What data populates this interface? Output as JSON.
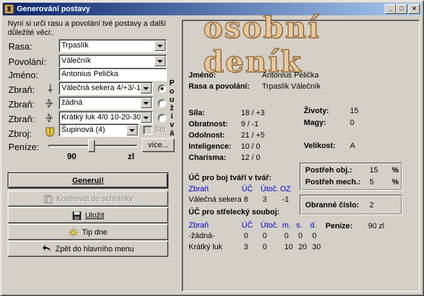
{
  "window": {
    "title": "Generování postavy",
    "btn_min": "_",
    "btn_max": "□",
    "btn_close": "×"
  },
  "form": {
    "intro": "Nyní si urči rasu a povolání tvé postavy a další důležité věci:.",
    "rasa_label": "Rasa:",
    "rasa_value": "Trpaslík",
    "povolani_label": "Povolání:",
    "povolani_value": "Válečník",
    "jmeno_label": "Jméno:",
    "jmeno_value": "Antonius Pelička",
    "zbran_label": "Zbraň:",
    "zbran1_value": "Válečná sekera  4/+3/-1",
    "zbran2_value": "žádná",
    "zbran3_value": "Krátký luk  4/0  10-20-30",
    "zbroj_label": "Zbroj:",
    "zbroj_value": "Šupinová (4)",
    "stit_label": "Štít",
    "pouziva_letters": [
      "P",
      "o",
      "u",
      "ž",
      "í",
      "v",
      "á"
    ],
    "penize_label": "Peníze:",
    "penize_value": "90",
    "penize_unit": "zl",
    "penize_slider_fraction": 0.48,
    "vice_button": "více..."
  },
  "buttons": {
    "generuj": "Generuj!",
    "kopirovat": "Kopírovat do schránky",
    "ulozit": "Uložit",
    "tip": "Tip dne",
    "zpet": "Zpět do hlavního menu"
  },
  "denik": {
    "title": "osobní deník",
    "jmeno_label": "Jméno:",
    "jmeno_value": "Antonius Pelička",
    "rasa_label": "Rasa a povolání:",
    "rasa_value": "Trpaslík Válečník",
    "stats": [
      {
        "label": "Síla:",
        "value": "18 / +3"
      },
      {
        "label": "Obratnost:",
        "value": "9 / -1"
      },
      {
        "label": "Odolnost:",
        "value": "21 / +5"
      },
      {
        "label": "Inteligence:",
        "value": "10 / 0"
      },
      {
        "label": "Charisma:",
        "value": "12 / 0"
      }
    ],
    "zivoty_label": "Životy:",
    "zivoty_value": "15",
    "magy_label": "Magy:",
    "magy_value": "0",
    "velikost_label": "Velikost:",
    "velikost_value": "A",
    "postreh_obj_label": "Postřeh obj.:",
    "postreh_obj_value": "15",
    "postreh_mech_label": "Postřeh mech.:",
    "postreh_mech_value": "5",
    "pct": "%",
    "obranne_label": "Obranné číslo:",
    "obranne_value": "2",
    "boj_title": "ÚČ pro boj tváří v tvář:",
    "boj_headers": [
      "Zbraň",
      "ÚČ",
      "Útoč.",
      "OZ"
    ],
    "boj_rows": [
      [
        "Válečná sekera",
        "8",
        "3",
        "-1"
      ]
    ],
    "strel_title": "ÚČ pro střelecký souboj:",
    "strel_headers": [
      "Zbraň",
      "ÚČ",
      "Útoč.",
      "m.",
      "s.",
      "d."
    ],
    "strel_rows": [
      [
        "-žádná-",
        "0",
        "0",
        "0",
        "0",
        "0"
      ],
      [
        "Krátký luk",
        "3",
        "0",
        "10",
        "20",
        "30"
      ]
    ],
    "penize_label": "Peníze:",
    "penize_value": "90 zl"
  }
}
